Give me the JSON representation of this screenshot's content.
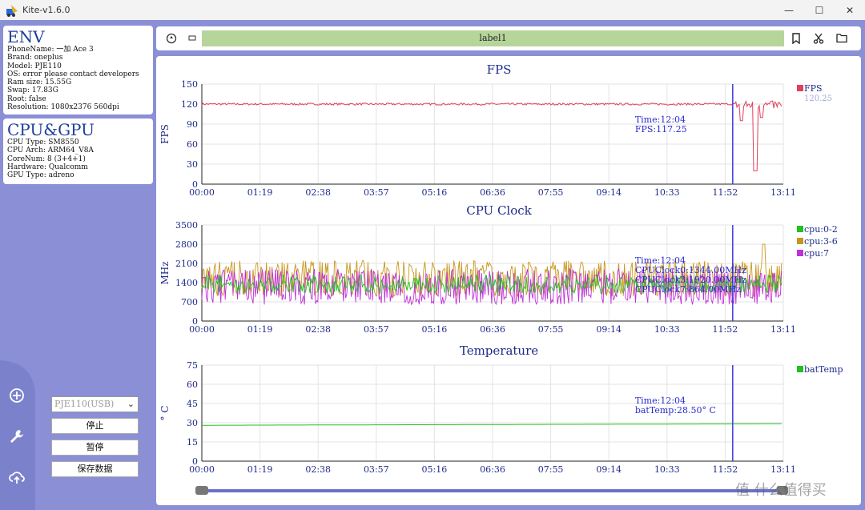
{
  "window": {
    "title": "Kite-v1.6.0",
    "minimize": "—",
    "maximize": "☐",
    "close": "✕"
  },
  "env": {
    "title": "ENV",
    "lines": [
      "PhoneName: 一加 Ace 3",
      "Brand: oneplus",
      "Model: PJE110",
      "OS: error please contact developers",
      "Ram size: 15.55G",
      "Swap: 17.83G",
      "Root: false",
      "Resolution: 1080x2376 560dpi"
    ]
  },
  "cpugpu": {
    "title": "CPU&GPU",
    "lines": [
      "CPU Type: SM8550",
      "CPU Arch: ARM64_V8A",
      "CoreNum: 8 (3+4+1)",
      "Hardware: Qualcomm",
      "GPU Type: adreno"
    ]
  },
  "controls": {
    "device_select": "PJE110(USB)",
    "stop": "停止",
    "pause": "暂停",
    "save": "保存数据"
  },
  "toolbar": {
    "label": "label1"
  },
  "icons": {
    "add": "plus-circle-icon",
    "settings": "wrench-icon",
    "upload": "cloud-upload-icon"
  },
  "xticks": [
    "00:00",
    "01:19",
    "02:38",
    "03:57",
    "05:16",
    "06:36",
    "07:55",
    "09:14",
    "10:33",
    "11:52",
    "13:11"
  ],
  "cursor_time": "12:04",
  "fps_chart": {
    "title": "FPS",
    "ylabel": "FPS",
    "ylim": [
      0,
      150
    ],
    "yticks": [
      "0",
      "30",
      "60",
      "90",
      "120",
      "150"
    ],
    "legend": [
      {
        "name": "FPS",
        "color": "#e0405a",
        "value": "120.25"
      }
    ],
    "tooltip": [
      "Time:12:04",
      "FPS:117.25"
    ]
  },
  "cpu_chart": {
    "title": "CPU Clock",
    "ylabel": "MHz",
    "ylim": [
      0,
      3500
    ],
    "yticks": [
      "0",
      "700",
      "1400",
      "2100",
      "2800",
      "3500"
    ],
    "legend": [
      {
        "name": "cpu:0-2",
        "color": "#22c022"
      },
      {
        "name": "cpu:3-6",
        "color": "#c8961e"
      },
      {
        "name": "cpu:7",
        "color": "#c030d8"
      }
    ],
    "tooltip": [
      "Time:12:04",
      "CPUClock0:1344.00MHz",
      "CPUClock3:1920.00MHz",
      "CPUClock7:864.00MHz"
    ]
  },
  "temp_chart": {
    "title": "Temperature",
    "ylabel": "° C",
    "ylim": [
      0,
      75
    ],
    "yticks": [
      "0",
      "15",
      "30",
      "45",
      "60",
      "75"
    ],
    "legend": [
      {
        "name": "batTemp",
        "color": "#22c022"
      }
    ],
    "tooltip": [
      "Time:12:04",
      "batTemp:28.50° C"
    ]
  },
  "chart_data": [
    {
      "type": "line",
      "title": "FPS",
      "ylabel": "FPS",
      "ylim": [
        0,
        150
      ],
      "x_range": [
        "00:00",
        "13:11"
      ],
      "series": [
        {
          "name": "FPS",
          "baseline": 120,
          "values_approx": [
            120,
            121,
            119,
            120,
            118,
            121,
            120,
            119,
            120,
            121,
            117,
            110,
            80,
            115,
            20,
            118,
            120
          ]
        }
      ]
    },
    {
      "type": "line",
      "title": "CPU Clock",
      "ylabel": "MHz",
      "ylim": [
        0,
        3500
      ],
      "x_range": [
        "00:00",
        "13:11"
      ],
      "series": [
        {
          "name": "cpu:0-2",
          "range": [
            900,
            1800
          ]
        },
        {
          "name": "cpu:3-6",
          "range": [
            900,
            2200
          ],
          "peak": 2800
        },
        {
          "name": "cpu:7",
          "range": [
            500,
            2000
          ]
        }
      ]
    },
    {
      "type": "line",
      "title": "Temperature",
      "ylabel": "° C",
      "ylim": [
        0,
        75
      ],
      "x_range": [
        "00:00",
        "13:11"
      ],
      "series": [
        {
          "name": "batTemp",
          "values_approx": [
            28,
            28.5,
            29,
            29.2,
            29
          ]
        }
      ]
    }
  ]
}
